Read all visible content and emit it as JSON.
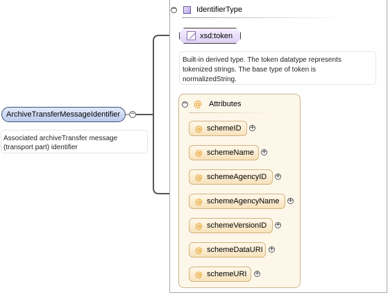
{
  "complex_type": {
    "name": "IdentifierType",
    "expand_symbol": "−"
  },
  "root_element": {
    "name": "ArchiveTransferMessageIdentifier",
    "expand_symbol": "−",
    "documentation": [
      "Associated archiveTransfer message",
      "(transport part) identifier"
    ]
  },
  "base_type": {
    "name": "xsd:token",
    "documentation": [
      "Built-in derived type. The token datatype represents",
      "tokenized strings. The base type of token is",
      "normalizedString."
    ]
  },
  "attributes": {
    "label": "Attributes",
    "at_symbol": "@",
    "expand_symbol": "−",
    "items": [
      {
        "name": "schemeID",
        "expand_symbol": "+"
      },
      {
        "name": "schemeName",
        "expand_symbol": "+"
      },
      {
        "name": "schemeAgencyID",
        "expand_symbol": "+"
      },
      {
        "name": "schemeAgencyName",
        "expand_symbol": "+"
      },
      {
        "name": "schemeVersionID",
        "expand_symbol": "+"
      },
      {
        "name": "schemeDataURI",
        "expand_symbol": "+"
      },
      {
        "name": "schemeURI",
        "expand_symbol": "+"
      }
    ]
  },
  "colors": {
    "element_fill": "#c4d2f0",
    "type_icon": "#b7a3e6",
    "attribute_fill": "#f7e2bb",
    "at_symbol": "#e8a430"
  }
}
